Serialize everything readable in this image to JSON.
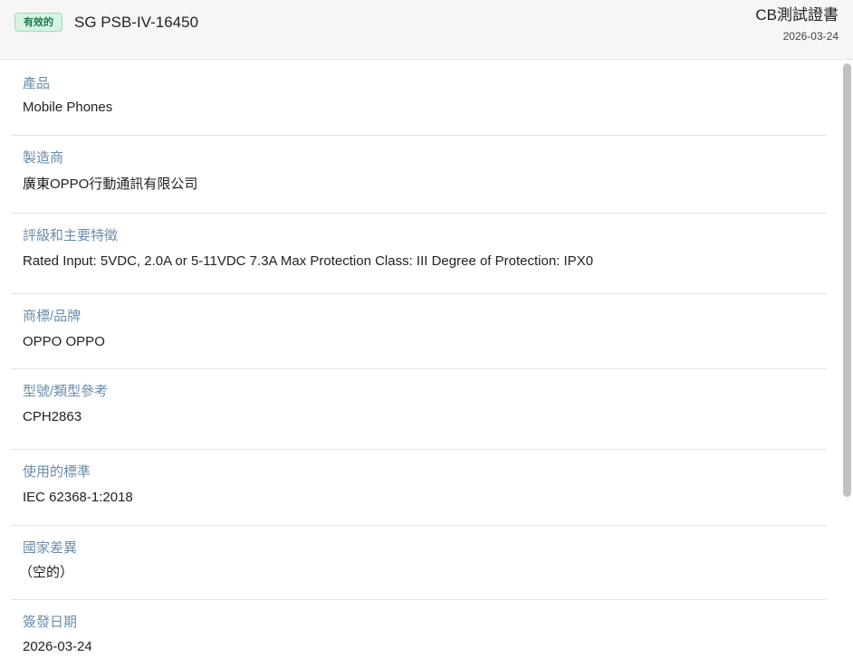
{
  "header": {
    "status_badge": "有效的",
    "certificate_number": "SG PSB-IV-16450",
    "certificate_type": "CB測試證書",
    "date": "2026-03-24"
  },
  "fields": [
    {
      "label": "產品",
      "value": "Mobile Phones"
    },
    {
      "label": "製造商",
      "value": "廣東OPPO行動通訊有限公司"
    },
    {
      "label": "評級和主要特徵",
      "value": "Rated Input: 5VDC, 2.0A or 5-11VDC 7.3A Max Protection Class: III Degree of Protection: IPX0"
    },
    {
      "label": "商標/品牌",
      "value": "OPPO OPPO"
    },
    {
      "label": "型號/類型參考",
      "value": "CPH2863"
    },
    {
      "label": "使用的標準",
      "value": "IEC 62368-1:2018"
    },
    {
      "label": "國家差異",
      "value": "（空的）"
    },
    {
      "label": "簽發日期",
      "value": "2026-03-24"
    }
  ],
  "colors": {
    "label": "#6b8cab",
    "badge_text": "#1f7a4a",
    "badge_bg": "#d6f4e4"
  }
}
